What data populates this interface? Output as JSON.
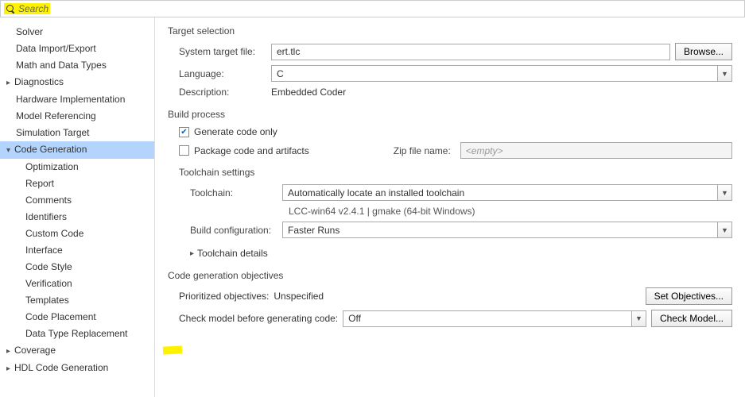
{
  "search": {
    "placeholder": "Search"
  },
  "sidebar": {
    "items": [
      {
        "label": "Solver"
      },
      {
        "label": "Data Import/Export"
      },
      {
        "label": "Math and Data Types"
      },
      {
        "label": "Diagnostics",
        "hasChildren": true
      },
      {
        "label": "Hardware Implementation"
      },
      {
        "label": "Model Referencing"
      },
      {
        "label": "Simulation Target"
      },
      {
        "label": "Code Generation",
        "hasChildren": true,
        "expanded": true,
        "selected": true
      },
      {
        "label": "Optimization",
        "child": true
      },
      {
        "label": "Report",
        "child": true
      },
      {
        "label": "Comments",
        "child": true
      },
      {
        "label": "Identifiers",
        "child": true
      },
      {
        "label": "Custom Code",
        "child": true
      },
      {
        "label": "Interface",
        "child": true
      },
      {
        "label": "Code Style",
        "child": true
      },
      {
        "label": "Verification",
        "child": true
      },
      {
        "label": "Templates",
        "child": true
      },
      {
        "label": "Code Placement",
        "child": true
      },
      {
        "label": "Data Type Replacement",
        "child": true
      },
      {
        "label": "Coverage",
        "hasChildren": true
      },
      {
        "label": "HDL Code Generation",
        "hasChildren": true
      }
    ]
  },
  "targetSelection": {
    "title": "Target selection",
    "systemTargetLabel": "System target file:",
    "systemTargetValue": "ert.tlc",
    "browse": "Browse...",
    "languageLabel": "Language:",
    "languageValue": "C",
    "descriptionLabel": "Description:",
    "descriptionValue": "Embedded Coder"
  },
  "buildProcess": {
    "title": "Build process",
    "genCodeOnly": "Generate code only",
    "packageCode": "Package code and artifacts",
    "zipLabel": "Zip file name:",
    "zipPlaceholder": "<empty>",
    "toolchainSettings": "Toolchain settings",
    "toolchainLabel": "Toolchain:",
    "toolchainValue": "Automatically locate an installed toolchain",
    "toolchainDesc": "LCC-win64 v2.4.1 | gmake (64-bit Windows)",
    "buildConfigLabel": "Build configuration:",
    "buildConfigValue": "Faster Runs",
    "toolchainDetails": "Toolchain details"
  },
  "objectives": {
    "title": "Code generation objectives",
    "prioritizedLabel": "Prioritized objectives:",
    "prioritizedValue": "Unspecified",
    "setObjectives": "Set Objectives...",
    "checkModelLabel": "Check model before generating code:",
    "checkModelValue": "Off",
    "checkModel": "Check Model..."
  }
}
